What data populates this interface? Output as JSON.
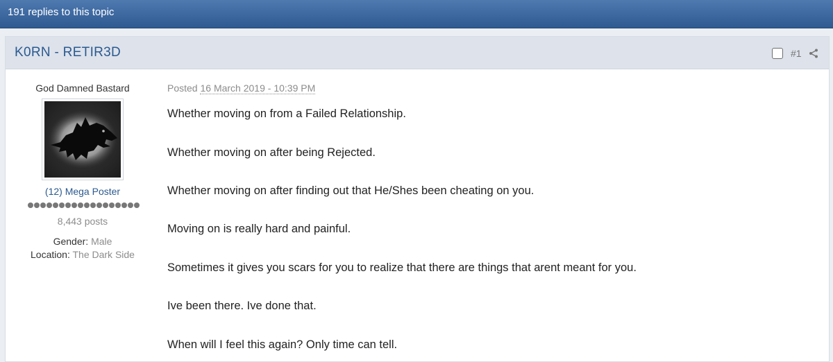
{
  "topic": {
    "replies_label": "191 replies to this topic"
  },
  "post": {
    "author": "K0RN - RETIR3D",
    "post_number": "#1",
    "posted_prefix": "Posted",
    "posted_date": "16 March 2019 - 10:39 PM",
    "paragraphs": [
      "Whether moving on from a Failed Relationship.",
      "Whether moving on after being Rejected.",
      "Whether moving on after finding out that He/Shes been cheating on you.",
      "Moving on is really hard and painful.",
      "Sometimes it gives you scars for you to realize that there are things that arent meant for you.",
      "Ive been there. Ive done that.",
      "When will I feel this again? Only time can tell."
    ]
  },
  "profile": {
    "user_title": "God Damned Bastard",
    "avatar_icon": "direwolf-sigil-icon",
    "rank": "(12) Mega Poster",
    "rank_pips": 18,
    "post_count": "8,443 posts",
    "gender_label": "Gender:",
    "gender_value": "Male",
    "location_label": "Location:",
    "location_value": "The Dark Side"
  },
  "colors": {
    "topbar": "#3c679f",
    "header_bg": "#dde2eb",
    "link": "#2b5a8f",
    "muted": "#8c8c8c"
  }
}
